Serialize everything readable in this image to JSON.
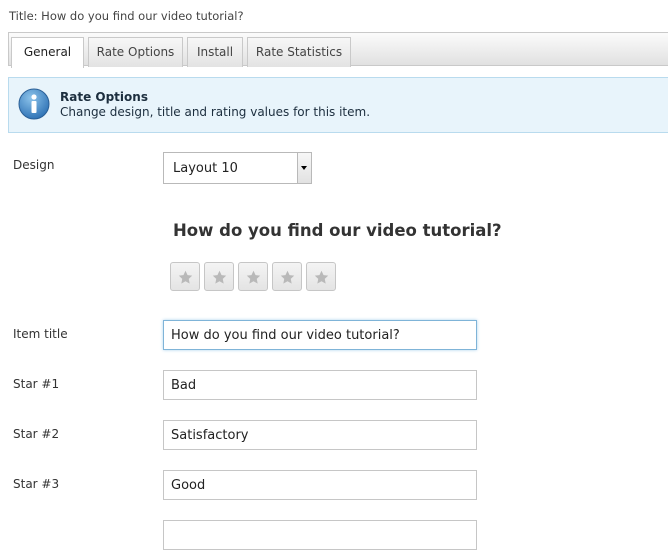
{
  "page": {
    "title": "Title: How do you find our video tutorial?"
  },
  "tabs": [
    {
      "label": "General",
      "active": true
    },
    {
      "label": "Rate Options",
      "active": false
    },
    {
      "label": "Install",
      "active": false
    },
    {
      "label": "Rate Statistics",
      "active": false
    }
  ],
  "info": {
    "icon": "info-icon",
    "title": "Rate Options",
    "text": "Change design, title and rating values for this item."
  },
  "design": {
    "label": "Design",
    "value": "Layout 10"
  },
  "preview": {
    "title": "How do you find our video tutorial?",
    "star_count": 5
  },
  "item_title": {
    "label": "Item title",
    "value": "How do you find our video tutorial?"
  },
  "stars": [
    {
      "label": "Star #1",
      "value": "Bad"
    },
    {
      "label": "Star #2",
      "value": "Satisfactory"
    },
    {
      "label": "Star #3",
      "value": "Good"
    }
  ],
  "colors": {
    "info_bg": "#e8f4fb",
    "info_border": "#b9dbee",
    "focus_border": "#7fb4d8"
  }
}
